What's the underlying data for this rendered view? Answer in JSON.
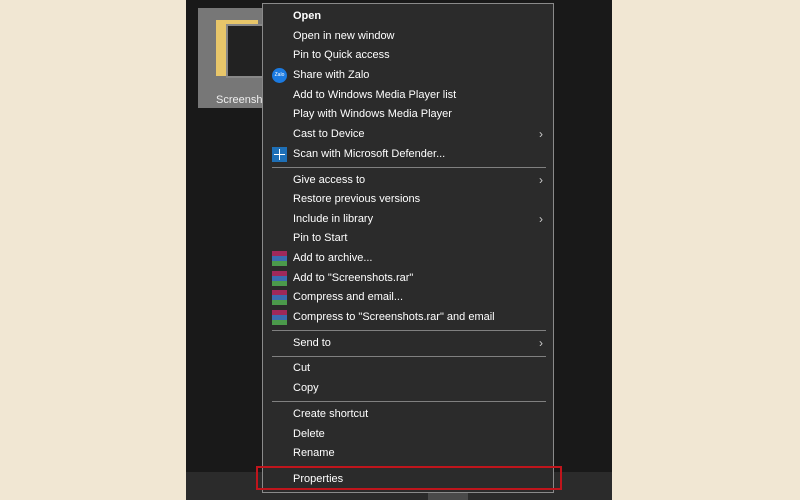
{
  "folder": {
    "label": "Screenshots"
  },
  "menu": {
    "open": "Open",
    "open_new_window": "Open in new window",
    "pin_quick": "Pin to Quick access",
    "share_zalo": "Share with Zalo",
    "zalo_icon_text": "Zalo",
    "add_wmp": "Add to Windows Media Player list",
    "play_wmp": "Play with Windows Media Player",
    "cast": "Cast to Device",
    "scan": "Scan with Microsoft Defender...",
    "give_access": "Give access to",
    "restore": "Restore previous versions",
    "include_lib": "Include in library",
    "pin_start": "Pin to Start",
    "add_archive": "Add to archive...",
    "add_rar": "Add to \"Screenshots.rar\"",
    "compress_email": "Compress and email...",
    "compress_rar_email": "Compress to \"Screenshots.rar\" and email",
    "send_to": "Send to",
    "cut": "Cut",
    "copy": "Copy",
    "create_shortcut": "Create shortcut",
    "delete": "Delete",
    "rename": "Rename",
    "properties": "Properties",
    "submenu_arrow": "›"
  },
  "highlight_color": "#c0151c"
}
